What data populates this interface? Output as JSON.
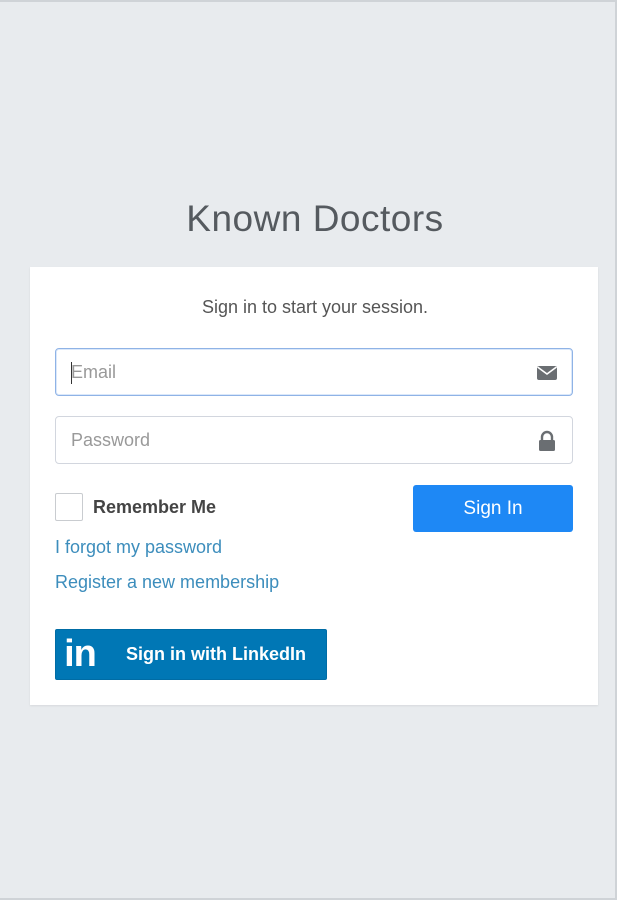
{
  "app": {
    "title": "Known Doctors"
  },
  "login": {
    "message": "Sign in to start your session.",
    "email": {
      "value": "",
      "placeholder": "Email",
      "icon": "envelope-icon"
    },
    "password": {
      "value": "",
      "placeholder": "Password",
      "icon": "lock-icon"
    },
    "remember_label": "Remember Me",
    "remember_checked": false,
    "signin_label": "Sign In",
    "forgot_link": "I forgot my password",
    "register_link": "Register a new membership",
    "linkedin": {
      "logo_text": "in",
      "label": "Sign in with LinkedIn"
    }
  },
  "colors": {
    "background": "#e8ebee",
    "primary": "#1e88f5",
    "link": "#3c8dbc",
    "linkedin": "#0077b5"
  }
}
